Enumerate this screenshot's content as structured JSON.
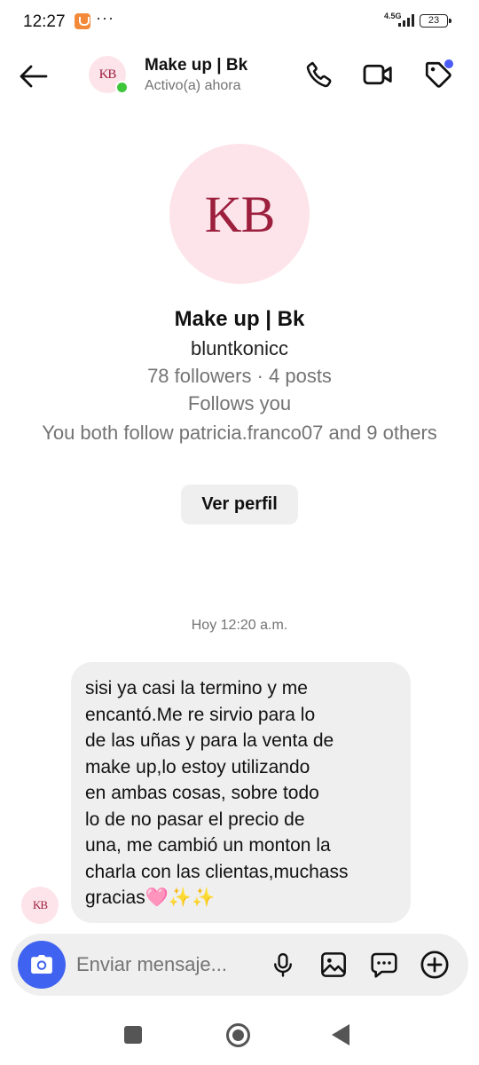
{
  "status_bar": {
    "time": "12:27",
    "dots": "···",
    "network_type": "4.5G",
    "battery": "23"
  },
  "header": {
    "contact_name": "Make up | Bk",
    "activity_status": "Activo(a) ahora",
    "avatar_logo": "KB"
  },
  "profile": {
    "avatar_logo": "KB",
    "name": "Make up | Bk",
    "username": "bluntkonicc",
    "stats": "78 followers · 4 posts",
    "follows_you": "Follows you",
    "mutual": "You both follow patricia.franco07 and 9 others",
    "view_profile_label": "Ver perfil"
  },
  "conversation": {
    "timestamp": "Hoy 12:20 a.m.",
    "messages": [
      {
        "sender": "Make up | Bk",
        "avatar_logo": "KB",
        "text": "sisi ya casi la termino y me\nencantó.Me re sirvio para lo\nde las uñas y para la venta de\nmake up,lo estoy utilizando\nen ambas cosas, sobre todo\nlo de no pasar el precio de\nuna, me cambió un monton la\ncharla con las clientas,muchass\ngracias🩷✨✨"
      }
    ]
  },
  "composer": {
    "placeholder": "Enviar mensaje..."
  },
  "icons": {
    "back": "arrow-left-icon",
    "call": "phone-icon",
    "video": "video-camera-icon",
    "tag": "tag-icon",
    "camera": "camera-icon",
    "mic": "microphone-icon",
    "gallery": "image-icon",
    "sticker": "sticker-chat-icon",
    "plus": "plus-circle-icon"
  },
  "colors": {
    "accent_blue": "#3f62f0",
    "online_green": "#3ec63a",
    "notification_dot": "#4a5cf5",
    "bubble_bg": "#efefef",
    "avatar_bg": "#fde4ea",
    "logo_red": "#9c1f3d"
  }
}
